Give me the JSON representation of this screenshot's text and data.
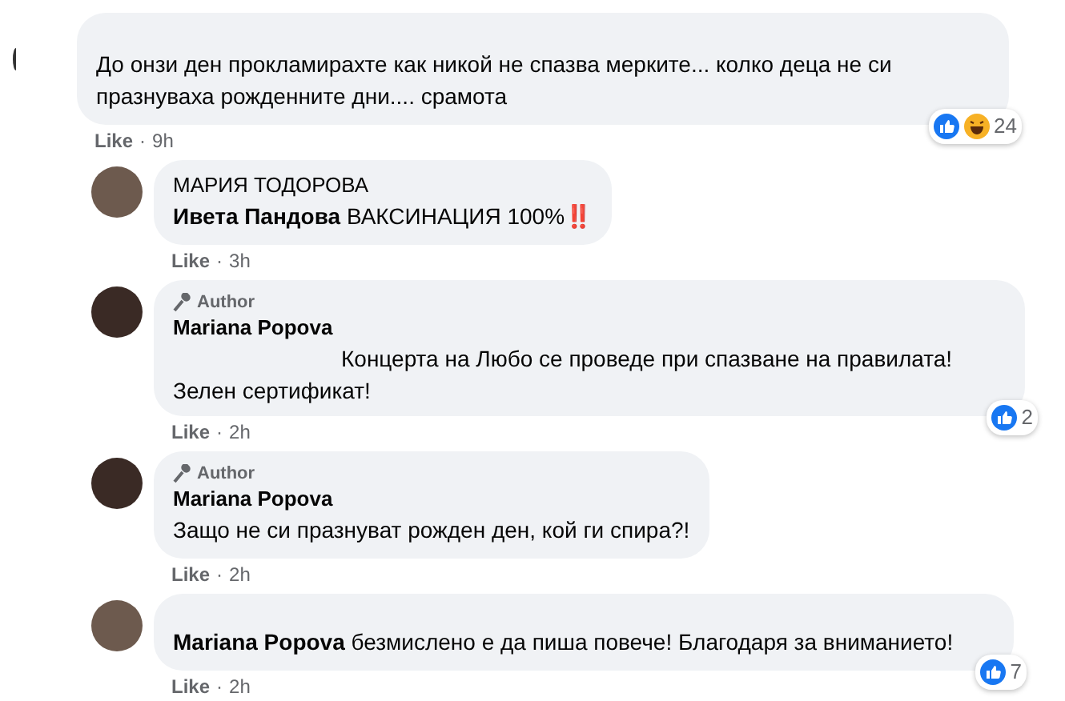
{
  "comments": [
    {
      "kind": "top",
      "author_badge": false,
      "text": "До онзи ден прокламирахте как никой не спазва мерките... колко деца не си празнуваха рожденните дни.... срамота",
      "like": "Like",
      "separator": "·",
      "time": "9h",
      "reactions": {
        "types": [
          {
            "kind": "like"
          },
          {
            "kind": "haha"
          }
        ],
        "count": "24"
      }
    },
    {
      "kind": "reply",
      "author_badge": false,
      "name": "МАРИЯ ТОДОРОВА",
      "text": "**Ивета Пандова** ВАКСИНАЦИЯ 100%‼️",
      "like": "Like",
      "separator": "·",
      "time": "3h"
    },
    {
      "kind": "reply",
      "author_badge": true,
      "badge_label": "Author",
      "name": "Mariana Popova",
      "text": "Концерта на Любо се проведе при спазване на правилата! Зелен сертификат!",
      "like": "Like",
      "separator": "·",
      "time": "2h",
      "reactions": {
        "types": [
          {
            "kind": "like"
          }
        ],
        "count": "2"
      }
    },
    {
      "kind": "reply",
      "author_badge": true,
      "badge_label": "Author",
      "name": "Mariana Popova",
      "text": "Защо не си празнуват рожден ден, кой ги спира?!",
      "like": "Like",
      "separator": "·",
      "time": "2h"
    },
    {
      "kind": "reply",
      "author_badge": false,
      "text": "**Mariana Popova** безмислено е да пиша повече! Благодаря за вниманието!",
      "like": "Like",
      "separator": "·",
      "time": "2h",
      "reactions": {
        "types": [
          {
            "kind": "like"
          }
        ],
        "count": "7"
      }
    }
  ]
}
